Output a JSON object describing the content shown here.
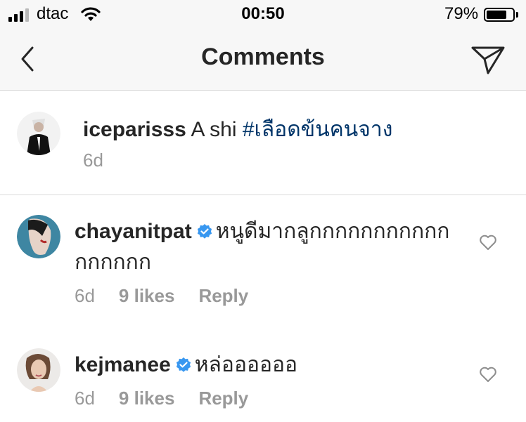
{
  "status_bar": {
    "carrier": "dtac",
    "time": "00:50",
    "battery_percent": "79%",
    "battery_level": 0.79,
    "signal_bars": 4,
    "signal_active_bars": 3
  },
  "nav": {
    "title": "Comments",
    "back_icon": "chevron-left-icon",
    "send_icon": "paper-plane-icon"
  },
  "caption": {
    "username": "iceparisss",
    "text": "A shi",
    "hashtag": "#เลือดข้นคนจาง",
    "time": "6d"
  },
  "comments": [
    {
      "username": "chayanitpat",
      "verified": true,
      "text": "หนูดีมากลูกกกกกกกกกกกกกกกกก",
      "time": "6d",
      "likes": "9 likes",
      "reply_label": "Reply"
    },
    {
      "username": "kejmanee",
      "verified": true,
      "text": "หล่ออออออ",
      "time": "6d",
      "likes": "9 likes",
      "reply_label": "Reply"
    }
  ],
  "colors": {
    "link": "#003569",
    "verified": "#3897f0",
    "muted": "#999999",
    "text": "#262626"
  }
}
